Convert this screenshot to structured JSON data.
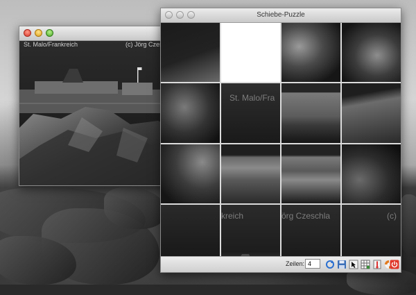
{
  "desktop": {
    "wallpaper": "rocky-coast-photo"
  },
  "photo_window": {
    "title": "",
    "caption_left": "St. Malo/Frankreich",
    "caption_right": "(c) Jörg Czeschla"
  },
  "puzzle_window": {
    "title": "Schiebe-Puzzle",
    "tile_texts": {
      "t2": "St. Malo/Fra",
      "t13": "kreich",
      "t14": "örg Czeschla",
      "t15": "(c)"
    },
    "rows_label": "Zeilen:",
    "rows_value": "4",
    "toolbar_icons": [
      "shuffle-icon",
      "save-icon",
      "cursor-icon",
      "grid-icon",
      "thermometer-icon",
      "help-lifebuoy-icon",
      "power-icon"
    ]
  },
  "colors": {
    "accent_power": "#e0382a",
    "empty_tile": "#ffffff"
  }
}
